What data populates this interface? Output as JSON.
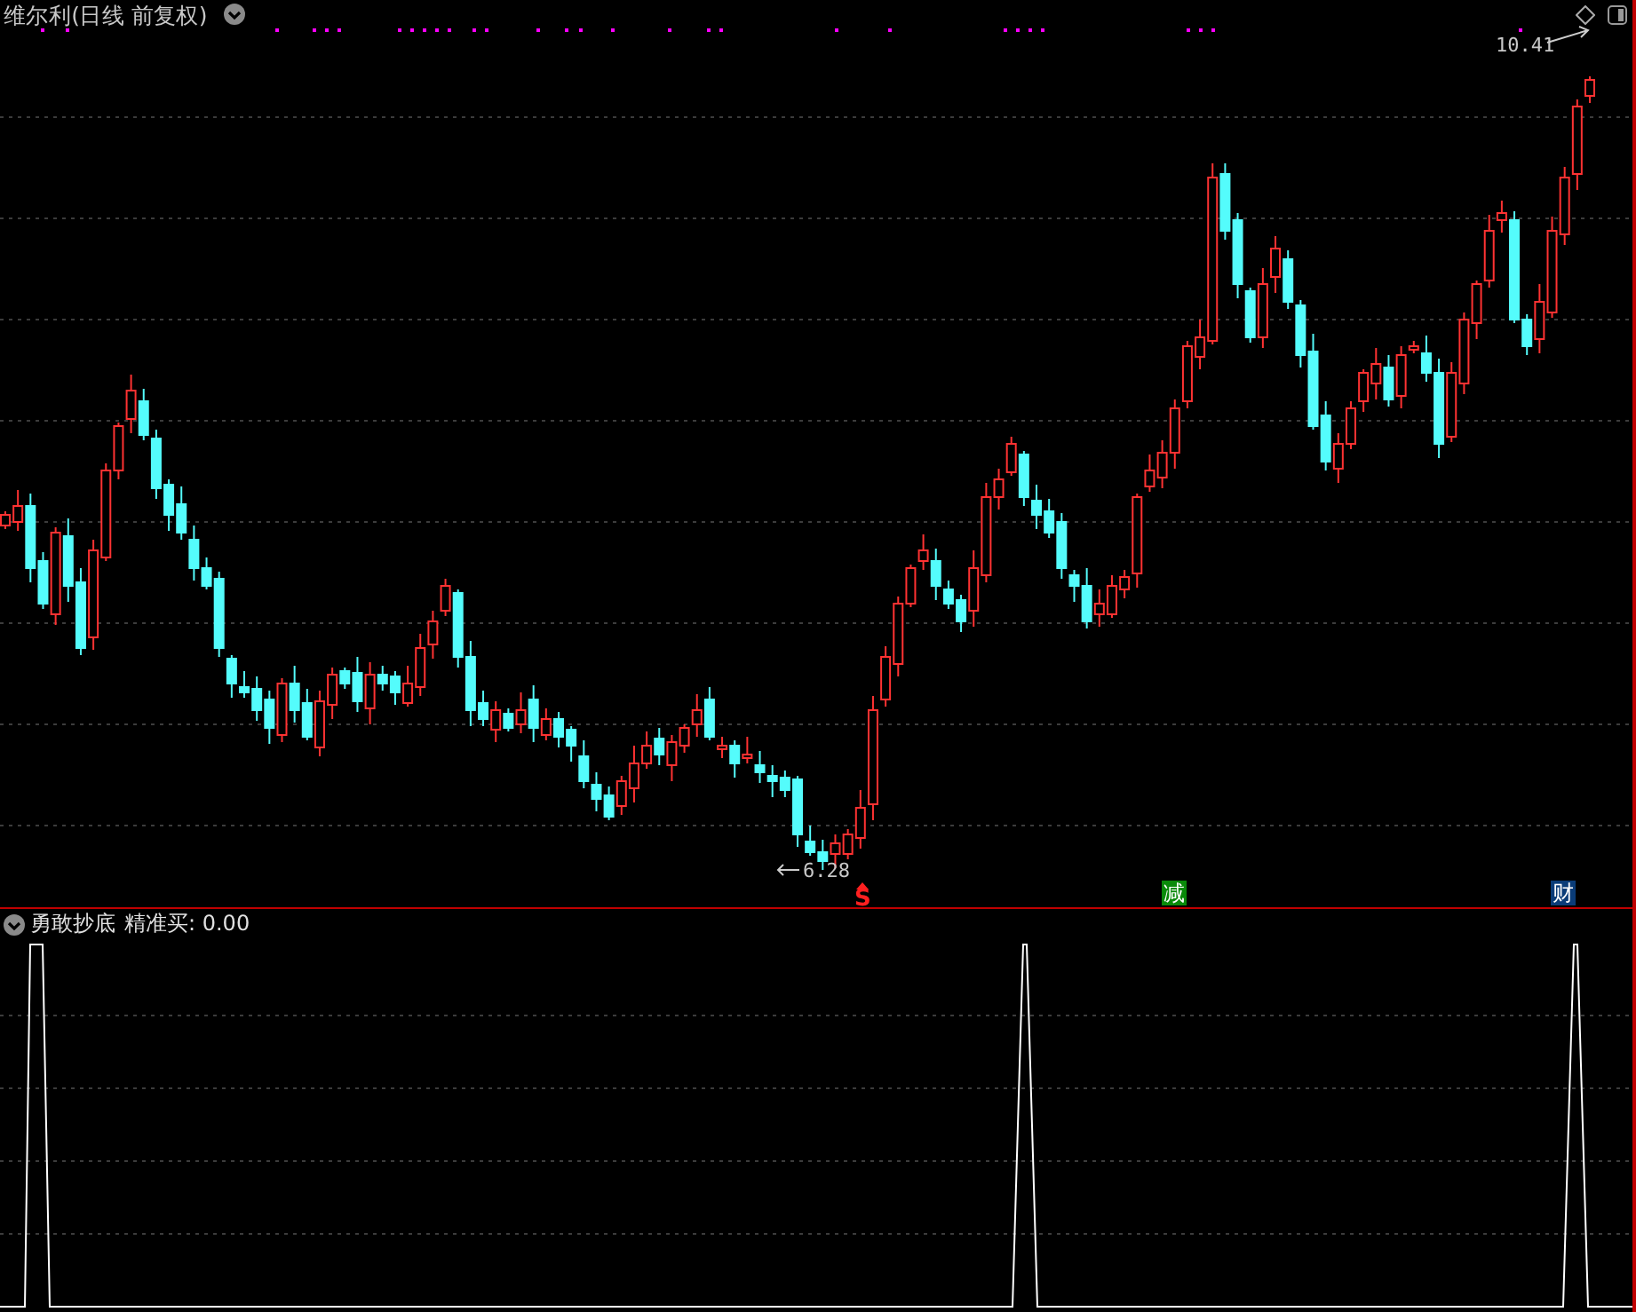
{
  "header": {
    "title": "维尔利(日线 前复权)"
  },
  "price_chart": {
    "high_label": "10.41",
    "low_label": "6.28",
    "signals": [
      {
        "kind": "arrow-s",
        "text": "S",
        "color": "#ff2020"
      },
      {
        "kind": "tag",
        "text": "减",
        "color": "#0a8a0a"
      },
      {
        "kind": "tag",
        "text": "财",
        "color": "#0a3c78"
      }
    ]
  },
  "indicator": {
    "name": "勇敢抄底",
    "reading": "精准买: 0.00"
  }
}
